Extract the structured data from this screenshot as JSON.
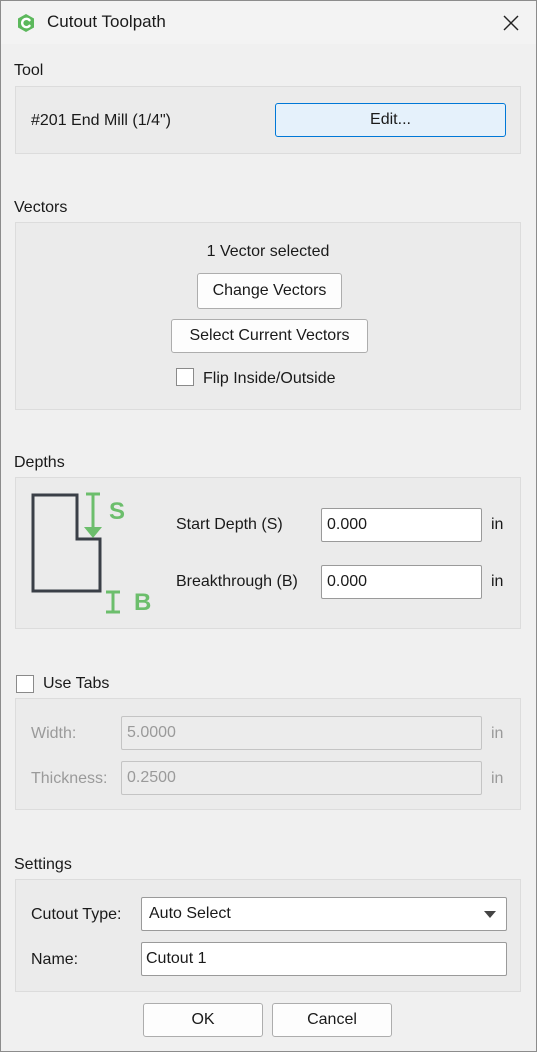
{
  "window": {
    "title": "Cutout Toolpath"
  },
  "tool": {
    "section_label": "Tool",
    "name": "#201 End Mill (1/4\")",
    "edit_label": "Edit..."
  },
  "vectors": {
    "section_label": "Vectors",
    "status": "1 Vector selected",
    "change_label": "Change Vectors",
    "select_current_label": "Select Current Vectors",
    "flip_label": "Flip Inside/Outside",
    "flip_checked": false
  },
  "depths": {
    "section_label": "Depths",
    "diagram": {
      "start_letter": "S",
      "breakthrough_letter": "B",
      "accent_color": "#6cbe6c"
    },
    "start_label": "Start Depth (S)",
    "start_value": "0.000",
    "start_unit": "in",
    "breakthrough_label": "Breakthrough (B)",
    "breakthrough_value": "0.000",
    "breakthrough_unit": "in"
  },
  "tabs": {
    "use_label": "Use Tabs",
    "use_checked": false,
    "width_label": "Width:",
    "width_value": "5.0000",
    "width_unit": "in",
    "thickness_label": "Thickness:",
    "thickness_value": "0.2500",
    "thickness_unit": "in"
  },
  "settings": {
    "section_label": "Settings",
    "cutout_type_label": "Cutout Type:",
    "cutout_type_value": "Auto Select",
    "name_label": "Name:",
    "name_value": "Cutout 1"
  },
  "footer": {
    "ok_label": "OK",
    "cancel_label": "Cancel"
  }
}
